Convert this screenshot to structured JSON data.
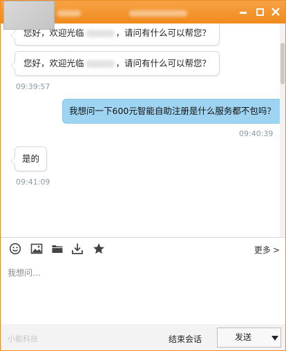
{
  "window": {
    "controls": {
      "minimize": "minimize",
      "maximize": "maximize",
      "close": "close"
    }
  },
  "chat": {
    "messages": [
      {
        "side": "in",
        "before": "您好，欢迎光临",
        "after": "，请问有什么可以帮您？"
      },
      {
        "side": "in",
        "before": "您好，欢迎光临",
        "after": "，请问有什么可以帮您？",
        "time": "09:39:57"
      },
      {
        "side": "out",
        "text": "我想问一下600元智能自助注册是什么服务都不包吗？",
        "time": "09:40:39"
      },
      {
        "side": "in",
        "text": "是的",
        "time": "09:41:09"
      }
    ]
  },
  "toolbar": {
    "icons": [
      "emoji-icon",
      "image-icon",
      "folder-icon",
      "download-icon",
      "star-icon"
    ],
    "more_label": "更多",
    "more_chevron": ">"
  },
  "input": {
    "value": "",
    "placeholder": "我想问..."
  },
  "footer": {
    "brand": "小能科技",
    "end_session_label": "结束会话",
    "send_label": "发送"
  },
  "colors": {
    "titlebar": "#f08a1c",
    "outgoing_bubble": "#9ed4f2",
    "incoming_bubble": "#ffffff",
    "timestamp": "#8a9aa6"
  }
}
